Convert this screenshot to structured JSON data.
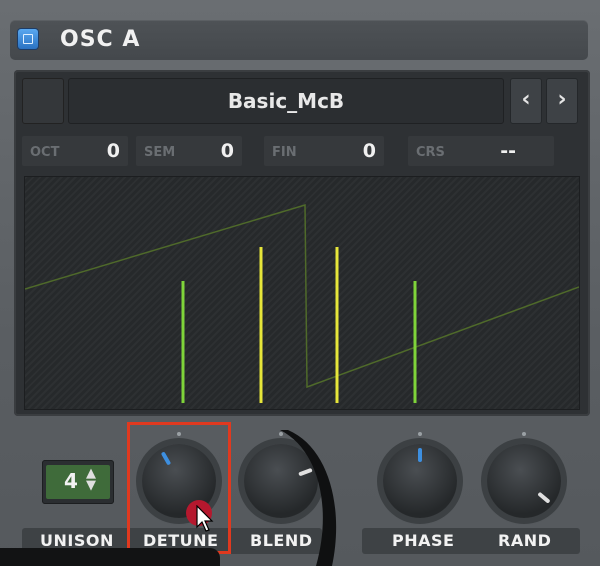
{
  "header": {
    "title": "OSC A",
    "power": "on"
  },
  "wavetable": {
    "name": "Basic_McB",
    "prev_label": "‹",
    "next_label": "›"
  },
  "tuning": [
    {
      "label": "OCT",
      "value": "0"
    },
    {
      "label": "SEM",
      "value": "0"
    },
    {
      "label": "FIN",
      "value": "0"
    },
    {
      "label": "CRS",
      "value": "--"
    }
  ],
  "controls": {
    "unison": {
      "value": "4",
      "label": "UNISON"
    },
    "detune": {
      "label": "DETUNE"
    },
    "blend": {
      "label": "BLEND"
    },
    "phase": {
      "label": "PHASE"
    },
    "rand": {
      "label": "RAND"
    }
  },
  "colors": {
    "accent_blue": "#3d8fe0",
    "unison_green": "#3f6b3a",
    "voice_green": "#7fd43a",
    "voice_yellow": "#e6e63a",
    "highlight_red": "#e0391f"
  },
  "icons": {
    "power": "power-toggle-icon",
    "spin": "up-down-arrows-icon"
  }
}
